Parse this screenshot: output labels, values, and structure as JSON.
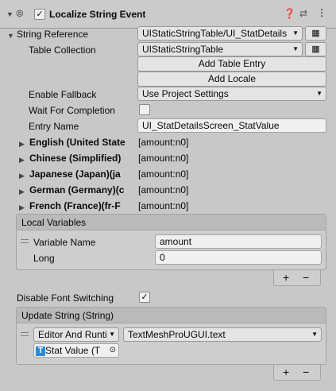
{
  "header": {
    "component_title": "Localize String Event",
    "enabled": true,
    "icons": [
      "fold-arrow",
      "script-event-icon",
      "help-icon",
      "preset-icon",
      "more-icon"
    ]
  },
  "string_reference": {
    "label": "String Reference",
    "value": "UIStaticStringTable/UI_StatDetails",
    "table_collection_label": "Table Collection",
    "table_collection_value": "UIStaticStringTable",
    "add_table_entry_label": "Add Table Entry",
    "add_locale_label": "Add Locale",
    "enable_fallback_label": "Enable Fallback",
    "enable_fallback_value": "Use Project Settings",
    "wait_label": "Wait For Completion",
    "wait_checked": false,
    "entry_name_label": "Entry Name",
    "entry_name_value": "UI_StatDetailsScreen_StatValue"
  },
  "locales": [
    {
      "name": "English (United State",
      "value": "[amount:n0]"
    },
    {
      "name": "Chinese (Simplified)",
      "value": "[amount:n0]"
    },
    {
      "name": "Japanese (Japan)(ja",
      "value": "[amount:n0]"
    },
    {
      "name": "German (Germany)(c",
      "value": "[amount:n0]"
    },
    {
      "name": "French (France)(fr-F",
      "value": "[amount:n0]"
    }
  ],
  "local_variables": {
    "title": "Local Variables",
    "var_name_label": "Variable Name",
    "var_name_value": "amount",
    "type_label": "Long",
    "type_value": "0",
    "add_label": "+",
    "remove_label": "−"
  },
  "disable_font_switching": {
    "label": "Disable Font Switching",
    "checked": true
  },
  "update_string": {
    "title": "Update String (String)",
    "runtime_value": "Editor And Runti",
    "function_value": "TextMeshProUGUI.text",
    "target_value": "Stat Value (T",
    "add_label": "+",
    "remove_label": "−"
  }
}
